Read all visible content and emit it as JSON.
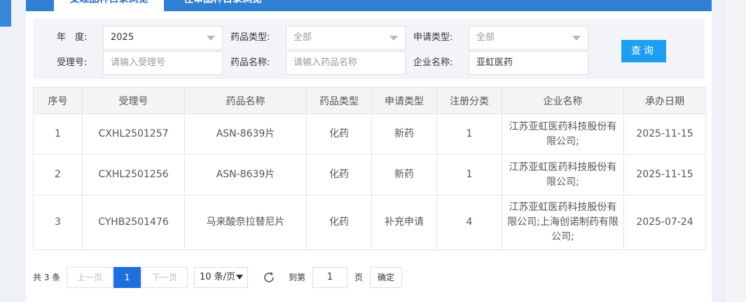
{
  "tabs": {
    "active_label": "受理品种目录浏览",
    "inactive_label": "在审品种目录浏览"
  },
  "filters": {
    "year_label": "年　度:",
    "year_value": "2025",
    "drug_type_label": "药品类型:",
    "drug_type_value": "全部",
    "apply_type_label": "申请类型:",
    "apply_type_value": "全部",
    "accept_no_label": "受理号:",
    "accept_no_placeholder": "请输入受理号",
    "drug_name_label": "药品名称:",
    "drug_name_placeholder": "请输入药品名称",
    "company_label": "企业名称:",
    "company_value": "亚虹医药",
    "query_label": "查询"
  },
  "table": {
    "headers": [
      "序号",
      "受理号",
      "药品名称",
      "药品类型",
      "申请类型",
      "注册分类",
      "企业名称",
      "承办日期"
    ],
    "rows": [
      [
        "1",
        "CXHL2501257",
        "ASN-8639片",
        "化药",
        "新药",
        "1",
        "江苏亚虹医药科技股份有限公司;",
        "2025-11-15"
      ],
      [
        "2",
        "CXHL2501256",
        "ASN-8639片",
        "化药",
        "新药",
        "1",
        "江苏亚虹医药科技股份有限公司;",
        "2025-11-15"
      ],
      [
        "3",
        "CYHB2501476",
        "马来酸奈拉替尼片",
        "化药",
        "补充申请",
        "4",
        "江苏亚虹医药科技股份有限公司;上海创诺制药有限公司;",
        "2025-07-24"
      ]
    ]
  },
  "pagination": {
    "total_text": "共 3 条",
    "prev_label": "上一页",
    "current_page": "1",
    "next_label": "下一页",
    "page_size": "10 条/页",
    "goto_label": "到第",
    "goto_value": "1",
    "page_unit": "页",
    "confirm_label": "确定"
  },
  "icons": {
    "refresh": "refresh-icon",
    "dropdown": "chevron-down-icon"
  },
  "colors": {
    "tab_bar": "#2f7fd3",
    "primary_button": "#1e9ff2",
    "current_page": "#1e6fdc"
  }
}
